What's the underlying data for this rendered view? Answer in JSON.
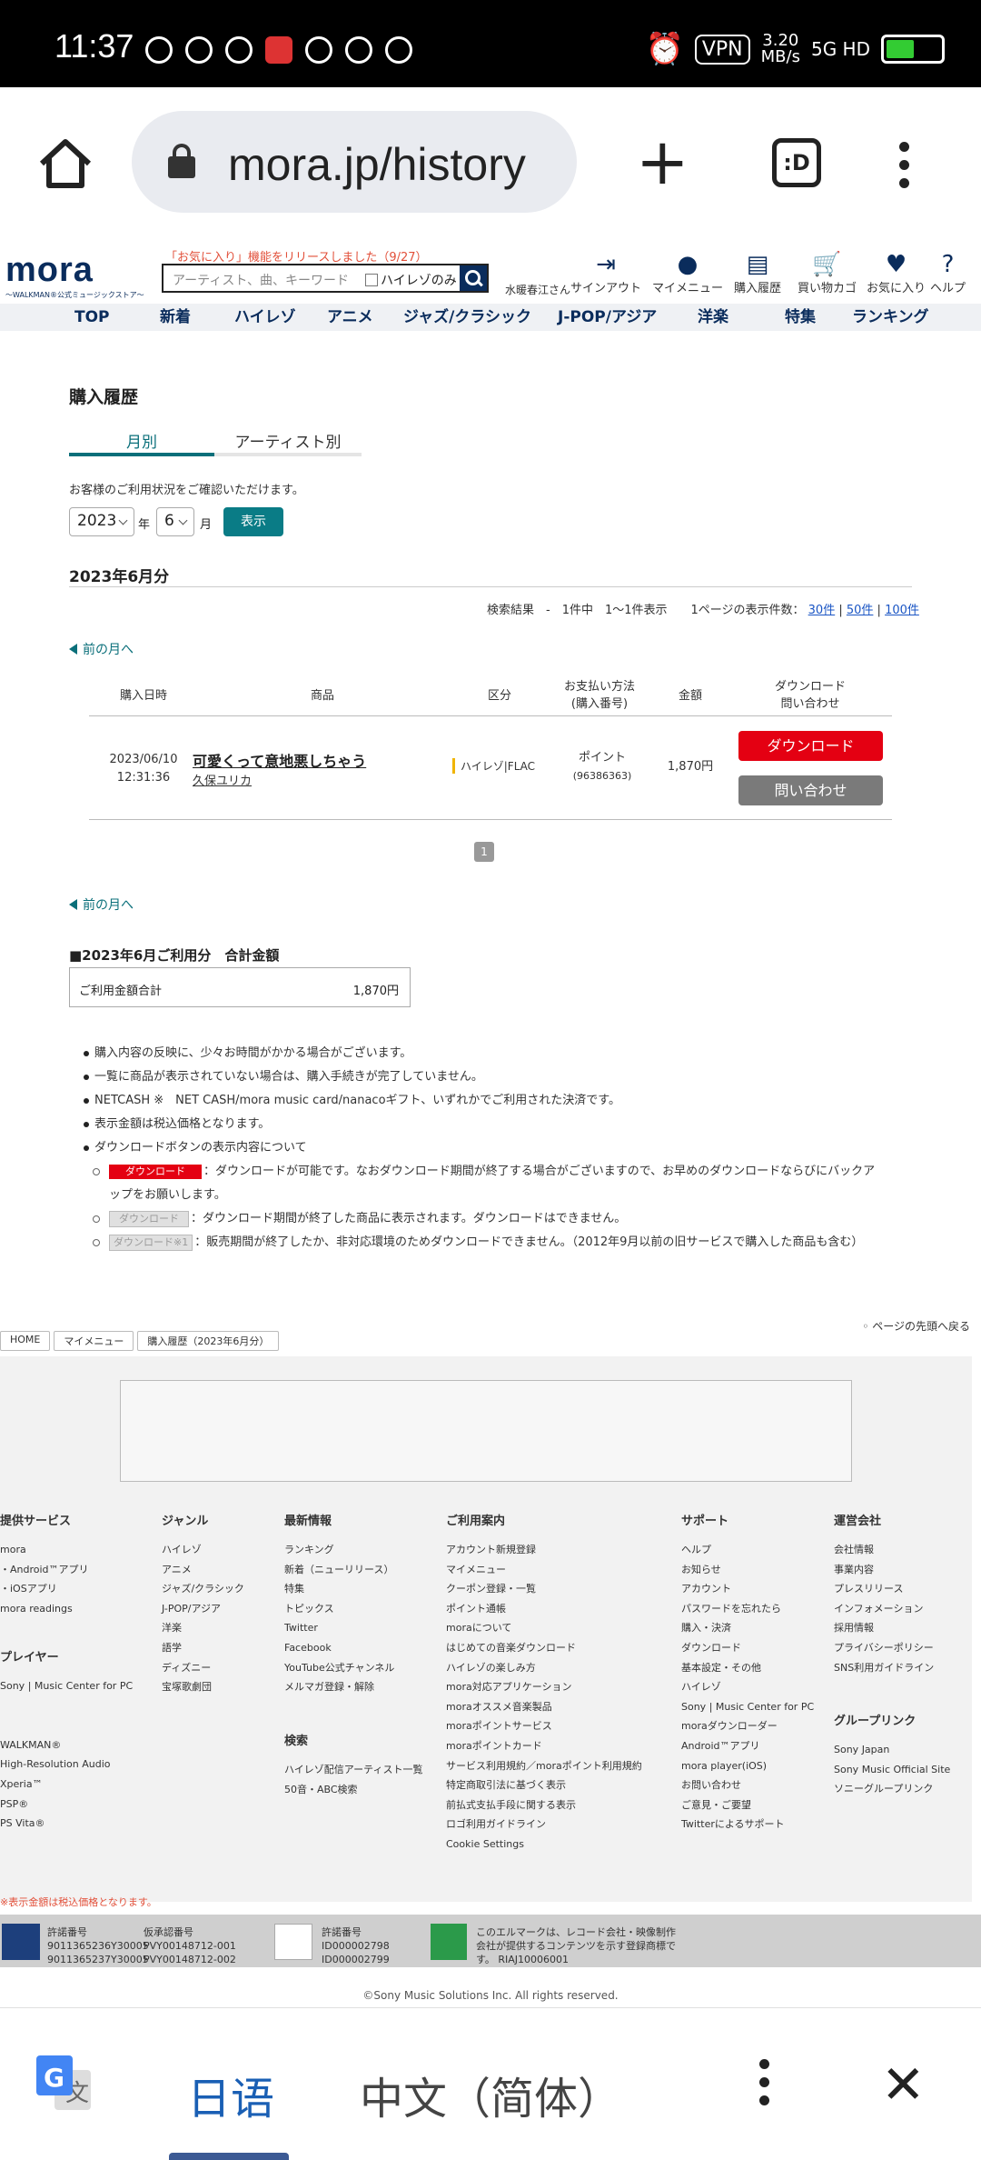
{
  "status": {
    "time": "11:37",
    "vpn": "VPN",
    "speed_top": "3.20",
    "speed_bottom": "MB/s",
    "network": "5G HD"
  },
  "browser": {
    "url": "mora.jp/history",
    "tabs_label": ":D"
  },
  "site": {
    "notice": "「お気に入り」機能をリリースしました（9/27）",
    "logo_word": "mora",
    "logo_tag": "〜WALKMAN®公式ミュージックストア〜",
    "search_placeholder": "アーティスト、曲、キーワード",
    "hires_only": "ハイレゾのみ",
    "user": "水暖春江さん",
    "header_nav": [
      {
        "label": "サインアウト",
        "icon": "signout-icon"
      },
      {
        "label": "マイメニュー",
        "icon": "user-icon"
      },
      {
        "label": "購入履歴",
        "icon": "document-icon"
      },
      {
        "label": "買い物カゴ",
        "icon": "cart-icon"
      },
      {
        "label": "お気に入り",
        "icon": "heart-icon"
      },
      {
        "label": "ヘルプ",
        "icon": "help-icon"
      }
    ],
    "global_nav": [
      "TOP",
      "新着",
      "ハイレゾ",
      "アニメ",
      "ジャズ/クラシック",
      "J-POP/アジア",
      "洋楽",
      "特集",
      "ランキング"
    ]
  },
  "main": {
    "title": "購入履歴",
    "tabs": [
      "月別",
      "アーティスト別"
    ],
    "confirm_text": "お客様のご利用状況をご確認いただけます。",
    "year": "2023",
    "year_label": "年",
    "month": "6",
    "month_label": "月",
    "show_button": "表示",
    "period_title": "2023年6月分",
    "results_text": "検索結果　-　1件中　1〜1件表示　　1ページの表示件数：",
    "page_sizes": [
      "30件",
      "50件",
      "100件"
    ],
    "prev_month": "前の月へ",
    "columns": [
      "購入日時",
      "商品",
      "区分",
      "お支払い方法\n(購入番号)",
      "金額",
      "ダウンロード\n問い合わせ"
    ],
    "rows": [
      {
        "date": "2023/06/10",
        "time": "12:31:36",
        "title": "可愛くって意地悪しちゃう",
        "artist": "久保ユリカ",
        "type": "ハイレゾ|FLAC",
        "payment": "ポイント",
        "order_no": "(96386363)",
        "amount": "1,870円",
        "download_label": "ダウンロード",
        "inquiry_label": "問い合わせ"
      }
    ],
    "page": "1",
    "total_heading": "■2023年6月ご利用分　合計金額",
    "total_label": "ご利用金額合計",
    "total_value": "1,870円",
    "notes": [
      "購入内容の反映に、少々お時間がかかる場合がございます。",
      "一覧に商品が表示されていない場合は、購入手続きが完了していません。",
      "NETCASH ※　NET CASH/mora music card/nanacoギフト、いずれかでご利用された決済です。",
      "表示金額は税込価格となります。",
      "ダウンロードボタンの表示内容について"
    ],
    "badge_labels": [
      "ダウンロード",
      "ダウンロード",
      "ダウンロード※1"
    ],
    "sub_notes": [
      "：ダウンロードが可能です。なおダウンロード期間が終了する場合がございますので、お早めのダウンロードならびにバックアップをお願いします。",
      "：ダウンロード期間が終了した商品に表示されます。ダウンロードはできません。",
      "：販売期間が終了したか、非対応環境のためダウンロードできません。（2012年9月以前の旧サービスで購入した商品も含む）"
    ],
    "to_top": "◦ ページの先頭へ戻る",
    "breadcrumbs": [
      "HOME",
      "マイメニュー",
      "購入履歴（2023年6月分）"
    ]
  },
  "footer": {
    "columns": [
      {
        "heading": "提供サービス",
        "items": [
          "mora",
          "・Android™アプリ",
          "・iOSアプリ",
          "mora readings"
        ]
      },
      {
        "heading": "プレイヤー",
        "items": [
          "Sony | Music Center for PC",
          "",
          "",
          "WALKMAN®",
          "High-Resolution Audio",
          "Xperia™",
          "PSP®",
          "PS Vita®"
        ]
      },
      {
        "heading": "ジャンル",
        "items": [
          "ハイレゾ",
          "アニメ",
          "ジャズ/クラシック",
          "J-POP/アジア",
          "洋楽",
          "語学",
          "ディズニー",
          "宝塚歌劇団"
        ]
      },
      {
        "heading": "最新情報",
        "items": [
          "ランキング",
          "新着（ニューリリース）",
          "特集",
          "トピックス",
          "Twitter",
          "Facebook",
          "YouTube公式チャンネル",
          "メルマガ登録・解除"
        ]
      },
      {
        "heading": "検索",
        "items": [
          "ハイレゾ配信アーティスト一覧",
          "50音・ABC検索"
        ]
      },
      {
        "heading": "ご利用案内",
        "items": [
          "アカウント新規登録",
          "マイメニュー",
          "クーポン登録・一覧",
          "ポイント通帳",
          "moraについて",
          "はじめての音楽ダウンロード",
          "ハイレゾの楽しみ方",
          "mora対応アプリケーション",
          "moraオススメ音楽製品",
          "moraポイントサービス",
          "moraポイントカード",
          "サービス利用規約／moraポイント利用規約",
          "特定商取引法に基づく表示",
          "前払式支払手段に関する表示",
          "ロゴ利用ガイドライン",
          "Cookie Settings"
        ]
      },
      {
        "heading": "サポート",
        "items": [
          "ヘルプ",
          "お知らせ",
          "アカウント",
          "パスワードを忘れたら",
          "購入・決済",
          "ダウンロード",
          "基本設定・その他",
          "ハイレゾ",
          "Sony | Music Center for PC",
          "moraダウンローダー",
          "Android™アプリ",
          "mora player(iOS)",
          "お問い合わせ",
          "ご意見・ご要望",
          "Twitterによるサポート"
        ]
      },
      {
        "heading": "運営会社",
        "items": [
          "会社情報",
          "事業内容",
          "プレスリリース",
          "インフォメーション",
          "採用情報",
          "プライバシーポリシー",
          "SNS利用ガイドライン"
        ]
      },
      {
        "heading": "グループリンク",
        "items": [
          "Sony Japan",
          "Sony Music Official Site",
          "ソニーグループリンク"
        ]
      }
    ],
    "tax_note": "※表示金額は税込価格となります。",
    "license": {
      "jasrac_label1": "許諾番号",
      "jasrac_label2": "仮承認番号",
      "jasrac_a": "9011365236Y30005",
      "jasrac_b": "9011365237Y30005",
      "temp_a": "PVY00148712-001",
      "temp_b": "PVY00148712-002",
      "nex_label": "許諾番号",
      "nex_a": "ID000002798",
      "nex_b": "ID000002799",
      "lmark_text": "このエルマークは、レコード会社・映像制作会社が提供するコンテンツを示す登録商標です。 RIAJ10006001"
    },
    "copyright": "©Sony Music Solutions Inc. All rights reserved."
  },
  "translate": {
    "source": "日语",
    "target": "中文（简体）"
  }
}
